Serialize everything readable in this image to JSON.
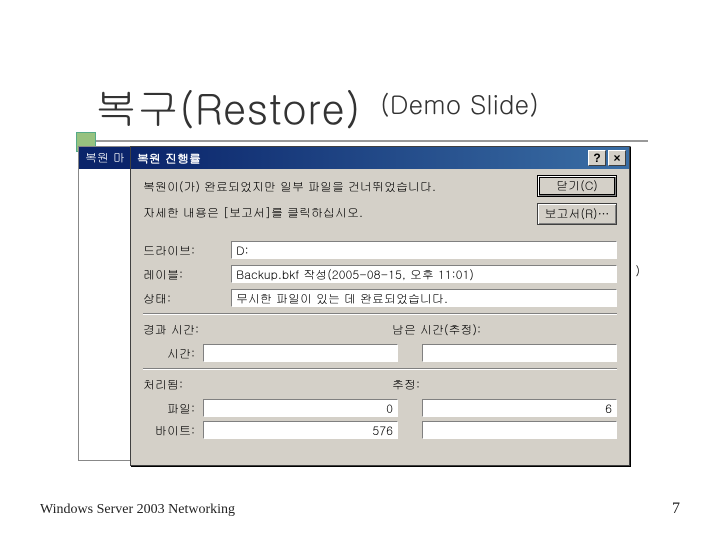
{
  "slide": {
    "title": "복구(Restore)",
    "subtitle": "(Demo Slide)",
    "footer": "Windows  Server 2003 Networking",
    "page_number": "7"
  },
  "back_window": {
    "title": "복원 마"
  },
  "dialog": {
    "title": "복원 진행률",
    "help_btn": "?",
    "close_btn": "×",
    "msg_line1": "복원이(가) 완료되었지만 일부 파일을 건너뛰었습니다.",
    "msg_line2": "자세한 내용은 [보고서]를 클릭하십시오.",
    "btn_close": "닫기(C)",
    "btn_report": "보고서(R)…",
    "labels": {
      "drive": "드라이브:",
      "label": "레이블:",
      "status": "상태:",
      "time": "시간:",
      "file": "파일:",
      "bytes": "바이트:",
      "elapsed": "경과 시간:",
      "remaining": "남은 시간(추정):",
      "processed": "처리됨:",
      "estimated": "추정:"
    },
    "values": {
      "drive": "D:",
      "label": "Backup.bkf 작성(2005-08-15, 오후 11:01)",
      "status": "무시한 파일이 있는 데 완료되었습니다.",
      "elapsed": "",
      "remaining": "",
      "file_processed": "0",
      "file_estimated": "6",
      "bytes_processed": "576",
      "bytes_estimated": ""
    }
  }
}
